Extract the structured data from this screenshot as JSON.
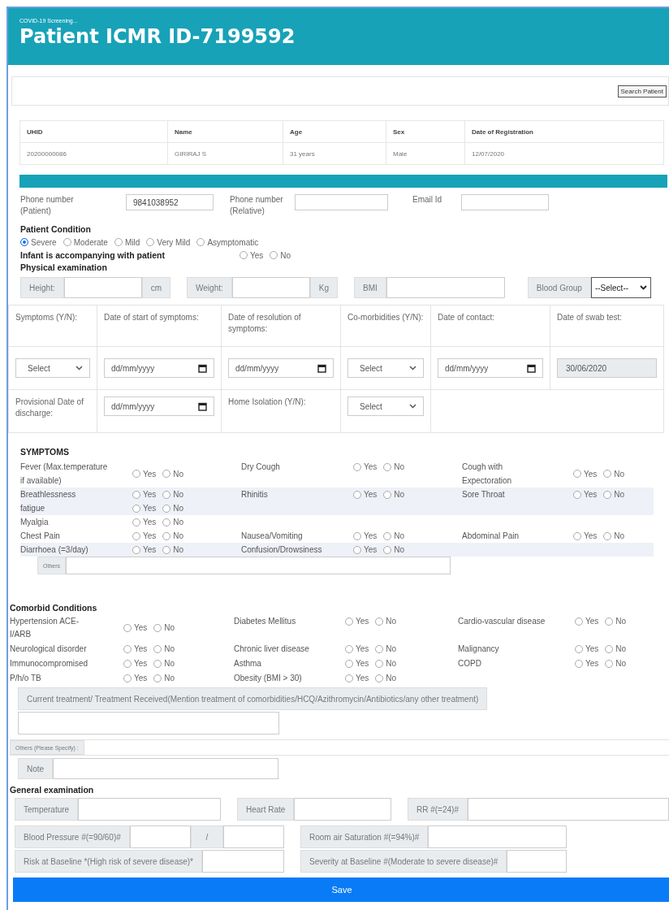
{
  "header": {
    "subtitle": "COVID-19 Screening...",
    "title": "Patient ICMR ID-7199592"
  },
  "search_button": "Search Patient",
  "patient_table": {
    "columns": [
      "UHID",
      "Name",
      "Age",
      "Sex",
      "Date of Registration"
    ],
    "rows": [
      [
        "20200000086",
        "GIRIRAJ S",
        "31 years",
        "Male",
        "12/07/2020"
      ]
    ]
  },
  "contact": [
    {
      "label": "Phone number (Patient)",
      "value": "9841038952"
    },
    {
      "label": "Phone number (Relative)"
    },
    {
      "label": "Email Id"
    }
  ],
  "patient_condition": {
    "title": "Patient Condition",
    "options": [
      {
        "label": "Severe",
        "selected": true
      },
      {
        "label": "Moderate",
        "selected": false
      },
      {
        "label": "Mild",
        "selected": false
      },
      {
        "label": "Very Mild",
        "selected": false
      },
      {
        "label": "Asymptomatic",
        "selected": false
      }
    ]
  },
  "infant": {
    "label": "Infant is accompanying with patient",
    "options": [
      {
        "label": "Yes",
        "selected": false
      },
      {
        "label": "No",
        "selected": false
      }
    ]
  },
  "physical": {
    "title": "Physical examination",
    "groups": [
      {
        "kind": "unit",
        "label": "Height:",
        "unit": "cm"
      },
      {
        "kind": "unit",
        "label": "Weight:",
        "unit": "Kg"
      },
      {
        "kind": "plain",
        "label": "BMI"
      },
      {
        "kind": "select",
        "label": "Blood Group",
        "value": "--Select--"
      }
    ]
  },
  "dates": {
    "columns": [
      "Symptoms (Y/N):",
      "Date of start of symptoms:",
      "Date of resolution of symptoms:",
      "Co-morbidities (Y/N):",
      "Date of contact:",
      "Date of swab test:"
    ],
    "rows": [
      [
        {
          "kind": "select",
          "value": "Select"
        },
        {
          "kind": "date",
          "placeholder": "dd/mm/yyyy"
        },
        {
          "kind": "date",
          "placeholder": "dd/mm/yyyy"
        },
        {
          "kind": "select",
          "value": "Select"
        },
        {
          "kind": "date",
          "placeholder": "dd/mm/yyyy"
        },
        {
          "kind": "readonly",
          "value": "30/06/2020"
        }
      ],
      [
        {
          "kind": "label",
          "text": "Provisional Date of discharge:"
        },
        {
          "kind": "date",
          "placeholder": "dd/mm/yyyy"
        },
        {
          "kind": "label",
          "text": "Home Isolation (Y/N):"
        },
        {
          "kind": "select",
          "value": "Select"
        }
      ]
    ]
  },
  "symptoms": {
    "title": "SYMPTOMS",
    "rows": [
      {
        "shaded": false,
        "cols": [
          [
            {
              "label": "Fever (Max.temperature if available)",
              "options": [
                {
                  "label": "Yes",
                  "selected": false
                },
                {
                  "label": "No",
                  "selected": false
                }
              ]
            }
          ],
          [
            {
              "label": "Dry Cough",
              "options": [
                {
                  "label": "Yes",
                  "selected": false
                },
                {
                  "label": "No",
                  "selected": false
                }
              ]
            }
          ],
          [
            {
              "label": "Cough with Expectoration",
              "options": [
                {
                  "label": "Yes",
                  "selected": false
                },
                {
                  "label": "No",
                  "selected": false
                }
              ]
            }
          ]
        ]
      },
      {
        "shaded": true,
        "cols": [
          [
            {
              "label": "Breathlessness",
              "options": [
                {
                  "label": "Yes",
                  "selected": false
                },
                {
                  "label": "No",
                  "selected": false
                }
              ]
            },
            {
              "label": "fatigue",
              "options": [
                {
                  "label": "Yes",
                  "selected": false
                },
                {
                  "label": "No",
                  "selected": false
                }
              ]
            }
          ],
          [
            {
              "label": "Rhinitis",
              "options": [
                {
                  "label": "Yes",
                  "selected": false
                },
                {
                  "label": "No",
                  "selected": false
                }
              ]
            }
          ],
          [
            {
              "label": "Sore Throat",
              "options": [
                {
                  "label": "Yes",
                  "selected": false
                },
                {
                  "label": "No",
                  "selected": false
                }
              ]
            }
          ]
        ]
      },
      {
        "shaded": false,
        "cols": [
          [
            {
              "label": "Myalgia",
              "options": [
                {
                  "label": "Yes",
                  "selected": false
                },
                {
                  "label": "No",
                  "selected": false
                }
              ]
            }
          ]
        ]
      },
      {
        "shaded": false,
        "cols": [
          [
            {
              "label": "Chest Pain",
              "options": [
                {
                  "label": "Yes",
                  "selected": false
                },
                {
                  "label": "No",
                  "selected": false
                }
              ]
            }
          ],
          [
            {
              "label": "Nausea/Vomiting",
              "options": [
                {
                  "label": "Yes",
                  "selected": false
                },
                {
                  "label": "No",
                  "selected": false
                }
              ]
            }
          ],
          [
            {
              "label": "Abdominal Pain",
              "options": [
                {
                  "label": "Yes",
                  "selected": false
                },
                {
                  "label": "No",
                  "selected": false
                }
              ]
            }
          ]
        ]
      },
      {
        "shaded": true,
        "cols": [
          [
            {
              "label": "Diarrhoea (=3/day)",
              "options": [
                {
                  "label": "Yes",
                  "selected": false
                },
                {
                  "label": "No",
                  "selected": false
                }
              ]
            }
          ],
          [
            {
              "label": "Confusion/Drowsiness",
              "options": [
                {
                  "label": "Yes",
                  "selected": false
                },
                {
                  "label": "No",
                  "selected": false
                }
              ]
            }
          ]
        ]
      }
    ],
    "others_label": "Others"
  },
  "comorbid": {
    "title": "Comorbid Conditions",
    "rows": [
      {
        "cols": [
          [
            {
              "label": "Hypertension ACE-I/ARB",
              "options": [
                {
                  "label": "Yes",
                  "selected": false
                },
                {
                  "label": "No",
                  "selected": false
                }
              ]
            }
          ],
          [
            {
              "label": "Diabetes Mellitus",
              "options": [
                {
                  "label": "Yes",
                  "selected": false
                },
                {
                  "label": "No",
                  "selected": false
                }
              ]
            }
          ],
          [
            {
              "label": "Cardio-vascular disease",
              "options": [
                {
                  "label": "Yes",
                  "selected": false
                },
                {
                  "label": "No",
                  "selected": false
                }
              ]
            }
          ]
        ]
      },
      {
        "cols": [
          [
            {
              "label": "Neurological disorder",
              "options": [
                {
                  "label": "Yes",
                  "selected": false
                },
                {
                  "label": "No",
                  "selected": false
                }
              ]
            }
          ],
          [
            {
              "label": "Chronic liver disease",
              "options": [
                {
                  "label": "Yes",
                  "selected": false
                },
                {
                  "label": "No",
                  "selected": false
                }
              ]
            }
          ],
          [
            {
              "label": "Malignancy",
              "options": [
                {
                  "label": "Yes",
                  "selected": false
                },
                {
                  "label": "No",
                  "selected": false
                }
              ]
            }
          ]
        ]
      },
      {
        "cols": [
          [
            {
              "label": "Immunocompromised",
              "options": [
                {
                  "label": "Yes",
                  "selected": false
                },
                {
                  "label": "No",
                  "selected": false
                }
              ]
            }
          ],
          [
            {
              "label": "Asthma",
              "options": [
                {
                  "label": "Yes",
                  "selected": false
                },
                {
                  "label": "No",
                  "selected": false
                }
              ]
            }
          ],
          [
            {
              "label": "COPD",
              "options": [
                {
                  "label": "Yes",
                  "selected": false
                },
                {
                  "label": "No",
                  "selected": false
                }
              ]
            }
          ]
        ]
      },
      {
        "cols": [
          [
            {
              "label": "P/h/o TB",
              "options": [
                {
                  "label": "Yes",
                  "selected": false
                },
                {
                  "label": "No",
                  "selected": false
                }
              ]
            }
          ],
          [
            {
              "label": "Obesity (BMI > 30)",
              "options": [
                {
                  "label": "Yes",
                  "selected": false
                },
                {
                  "label": "No",
                  "selected": false
                }
              ]
            }
          ]
        ]
      }
    ],
    "treatment_label": "Current treatment/ Treatment Received(Mention treatment of comorbidities/HCQ/Azithromycin/Antibiotics/any other treatment)",
    "others_specify_label": "Others (Please Specify) :",
    "note_label": "Note"
  },
  "general": {
    "title": "General examination",
    "rows": [
      [
        {
          "label": "Temperature"
        },
        {
          "label": "Heart Rate"
        },
        {
          "label": "RR #(=24)#"
        }
      ],
      [
        {
          "label": "Blood Pressure #(=90/60)#",
          "separator": "/"
        },
        {
          "label": "Room air Saturation #(=94%)#"
        }
      ],
      [
        {
          "label": "Risk at Baseline *(High risk of severe disease)*"
        },
        {
          "label": "Severity at Baseline #(Moderate to severe disease)#"
        }
      ]
    ]
  },
  "save_button": "Save"
}
